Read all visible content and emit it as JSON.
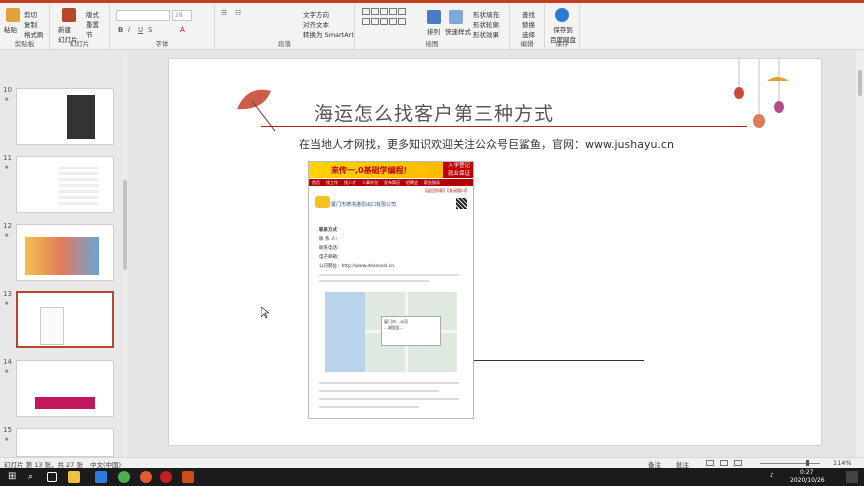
{
  "ribbon": {
    "clipboard": {
      "paste": "粘贴",
      "cut": "剪切",
      "copy": "复制",
      "format_painter": "格式刷",
      "label": "剪贴板"
    },
    "slides": {
      "new_slide": "新建\n幻灯片",
      "layout": "版式",
      "reset": "重置",
      "section": "节",
      "label": "幻灯片"
    },
    "font": {
      "label": "字体",
      "font_name": "",
      "font_size": "28"
    },
    "paragraph": {
      "label": "段落",
      "text_direction": "文字方向",
      "align_text": "对齐文本",
      "smartart": "转换为 SmartArt"
    },
    "drawing": {
      "label": "绘图",
      "arrange": "排列",
      "quick_styles": "快速样式",
      "fill": "形状填充",
      "outline": "形状轮廓",
      "effects": "形状效果"
    },
    "editing": {
      "label": "编辑",
      "find": "查找",
      "replace": "替换",
      "select": "选择"
    },
    "save": {
      "label": "保存到\n百度网盘",
      "group": "保存"
    }
  },
  "thumbnails": [
    {
      "num": "10",
      "star": "★"
    },
    {
      "num": "11",
      "star": "★"
    },
    {
      "num": "12",
      "star": "★"
    },
    {
      "num": "13",
      "star": "★"
    },
    {
      "num": "14",
      "star": "★"
    },
    {
      "num": "15",
      "star": "★"
    }
  ],
  "slide": {
    "title": "海运怎么找客户第三种方式",
    "subtitle": "在当地人才网找，更多知识欢迎关注公众号巨鲨鱼，官网：www.jushayu.cn"
  },
  "screenshot": {
    "banner_text": "来传一,0基础学编程!",
    "banner_cta": "入学登记\n就业保证",
    "nav": [
      "首页",
      "找工作",
      "找人才",
      "人事外包",
      "发布简历",
      "招聘会",
      "职业指导"
    ],
    "crumb": "【返回列表】【关闭窗口】",
    "company": "厦门市德书港恩出口有限公司",
    "contact_title": "联系方式",
    "contact_lines": [
      "联 系 人：",
      "联系电话：",
      "电子邮箱：",
      "公司网址：http://www.decoseal.cn"
    ],
    "map_popup": "厦门市...公司\n...湖里区..."
  },
  "status": {
    "slide_info": "幻灯片 第 13 张，共 27 张",
    "lang": "中文(中国)",
    "notes": "备注",
    "comments": "批注",
    "zoom": "114%"
  },
  "taskbar": {
    "time": "0:27",
    "date": "2020/10/26"
  }
}
